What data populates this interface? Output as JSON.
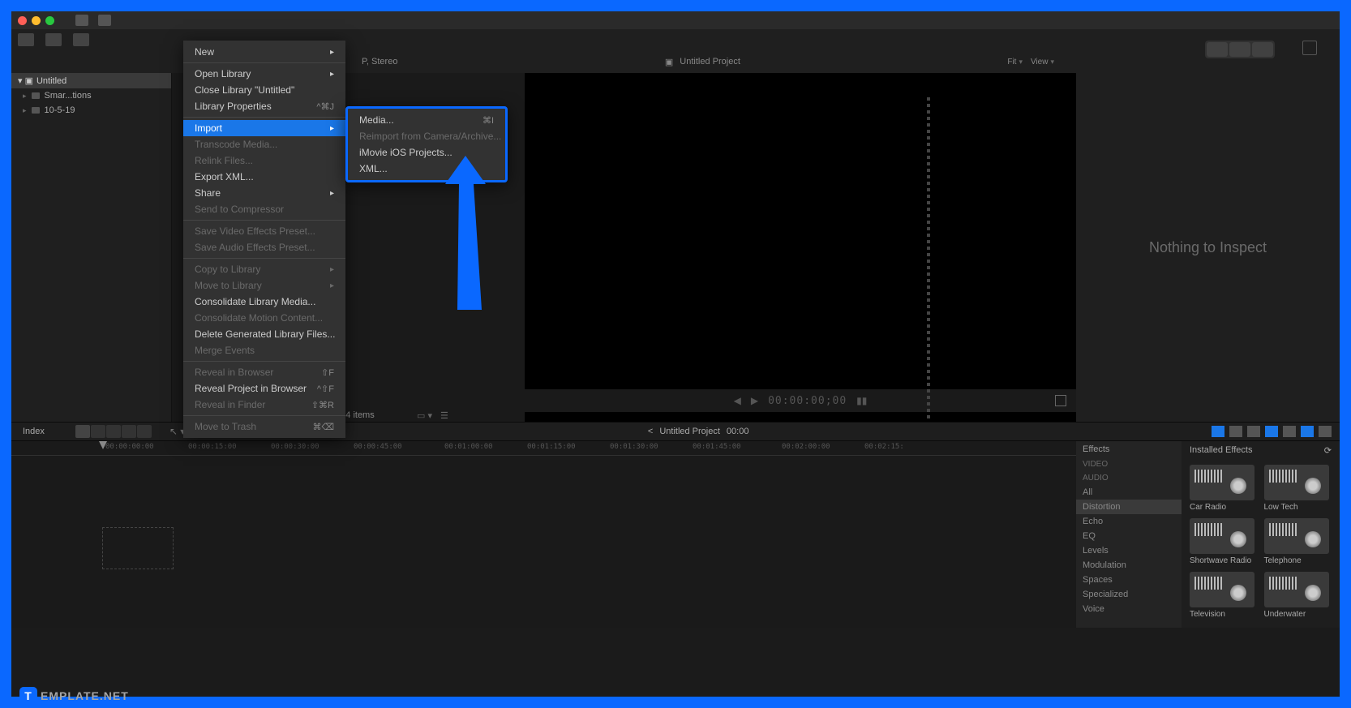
{
  "sidebar": {
    "library": "Untitled",
    "items": [
      {
        "label": "Smar...tions"
      },
      {
        "label": "10-5-19"
      }
    ]
  },
  "menu": {
    "new": "New",
    "open_library": "Open Library",
    "close_library": "Close Library \"Untitled\"",
    "library_properties": "Library Properties",
    "library_properties_shortcut": "^⌘J",
    "import": "Import",
    "transcode": "Transcode Media...",
    "relink": "Relink Files...",
    "export_xml": "Export XML...",
    "share": "Share",
    "send_to_compressor": "Send to Compressor",
    "save_video_fx": "Save Video Effects Preset...",
    "save_audio_fx": "Save Audio Effects Preset...",
    "copy_to_library": "Copy to Library",
    "move_to_library": "Move to Library",
    "consolidate_library": "Consolidate Library Media...",
    "consolidate_motion": "Consolidate Motion Content...",
    "delete_generated": "Delete Generated Library Files...",
    "merge_events": "Merge Events",
    "reveal_browser": "Reveal in Browser",
    "reveal_browser_shortcut": "⇧F",
    "reveal_project": "Reveal Project in Browser",
    "reveal_project_shortcut": "^⇧F",
    "reveal_finder": "Reveal in Finder",
    "reveal_finder_shortcut": "⇧⌘R",
    "move_trash": "Move to Trash",
    "move_trash_shortcut": "⌘⌫"
  },
  "submenu": {
    "media": "Media...",
    "media_shortcut": "⌘I",
    "reimport": "Reimport from Camera/Archive...",
    "imovie": "iMovie iOS Projects...",
    "xml": "XML..."
  },
  "viewer": {
    "format": "P, Stereo",
    "title": "Untitled Project",
    "fit": "Fit",
    "view": "View",
    "timecode": "00:00:00;00"
  },
  "inspector": {
    "empty": "Nothing to Inspect"
  },
  "browser": {
    "items": "4 items"
  },
  "timeline": {
    "index": "Index",
    "project": "Untitled Project",
    "timecode": "00:00",
    "ticks": [
      "00:00:00:00",
      "00:00:15:00",
      "00:00:30:00",
      "00:00:45:00",
      "00:01:00:00",
      "00:01:15:00",
      "00:01:30:00",
      "00:01:45:00",
      "00:02:00:00",
      "00:02:15:"
    ]
  },
  "effects": {
    "header": "Effects",
    "installed": "Installed Effects",
    "video_group": "VIDEO",
    "audio_group": "AUDIO",
    "cats": [
      "All",
      "Distortion",
      "Echo",
      "EQ",
      "Levels",
      "Modulation",
      "Spaces",
      "Specialized",
      "Voice"
    ],
    "thumbs": [
      "Car Radio",
      "Low Tech",
      "Shortwave Radio",
      "Telephone",
      "Television",
      "Underwater"
    ]
  },
  "watermark": {
    "brand": "EMPLATE.NET",
    "icon": "T"
  }
}
